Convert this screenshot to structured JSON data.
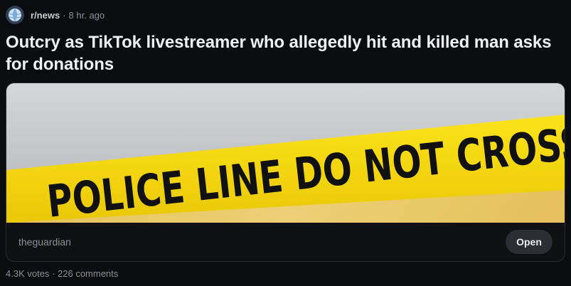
{
  "post": {
    "subreddit": "r/news",
    "age": "8 hr. ago",
    "title": "Outcry as TikTok livestreamer who allegedly hit and killed man asks for donations",
    "link": {
      "image_text": "POLICE LINE DO NOT CROSS",
      "domain": "theguardian",
      "open_label": "Open"
    },
    "stats": {
      "votes": "4.3K votes",
      "comments": "226 comments"
    }
  },
  "icons": {
    "avatar": "globe-icon"
  },
  "colors": {
    "background": "#0b0c0f",
    "tape_yellow": "#f2d408",
    "text_primary": "#eef1f3",
    "text_secondary": "#8b9196",
    "button_bg": "#2b2e33"
  }
}
